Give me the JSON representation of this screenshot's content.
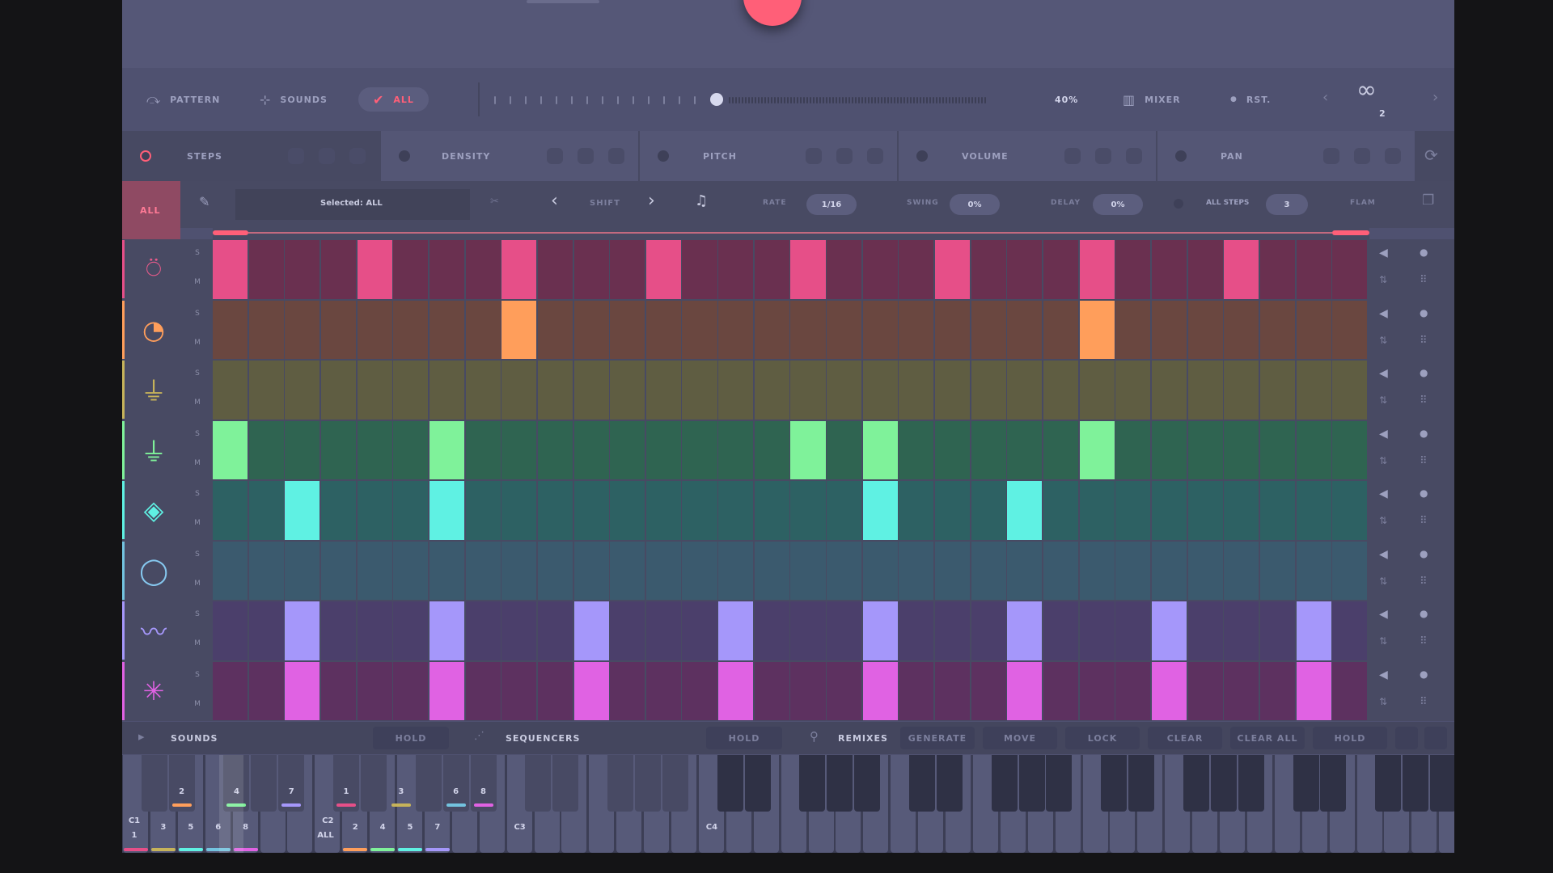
{
  "toolbar": {
    "pattern": "PATTERN",
    "sounds": "SOUNDS",
    "all": "ALL",
    "percent": "40%",
    "mixer": "MIXER",
    "rst": "RST.",
    "loop_count": "2"
  },
  "tabs": {
    "steps": "STEPS",
    "density": "DENSITY",
    "pitch": "PITCH",
    "volume": "VOLUME",
    "pan": "PAN"
  },
  "options": {
    "all_tab": "ALL",
    "selected": "Selected: ALL",
    "shift": "SHIFT",
    "rate_label": "RATE",
    "rate_value": "1/16",
    "swing_label": "SWING",
    "swing_value": "0%",
    "delay_label": "DELAY",
    "delay_value": "0%",
    "all_steps_label": "ALL STEPS",
    "all_steps_value": "3",
    "flam": "FLAM"
  },
  "row_markers": {
    "solo": "S",
    "mute": "M"
  },
  "colors": {
    "row_bg": [
      "#6a3050",
      "#6a4740",
      "#5f5d42",
      "#2f6451",
      "#2d6163",
      "#3b5a6e",
      "#4b3f6b",
      "#5d3160"
    ],
    "row_on": [
      "#e64f88",
      "#ff9e5b",
      "#c6b35a",
      "#7ff29a",
      "#5ff1e3",
      "#73c3df",
      "#a597fa",
      "#e062e3"
    ],
    "row_icon": [
      "#e65a8a",
      "#ff9e5b",
      "#c6b35a",
      "#7ff29a",
      "#5ff1e3",
      "#86c8ef",
      "#a597fa",
      "#e062e3"
    ]
  },
  "tracks": [
    {
      "icon": "kick-drum-icon",
      "glyph": "⍥",
      "steps": [
        0,
        4,
        8,
        12,
        16,
        20,
        24,
        28
      ]
    },
    {
      "icon": "snare-icon",
      "glyph": "◔",
      "steps": [
        8,
        24
      ]
    },
    {
      "icon": "hihat-closed-icon",
      "glyph": "⏚",
      "steps": []
    },
    {
      "icon": "hihat-open-icon",
      "glyph": "⏚",
      "steps": [
        0,
        6,
        16,
        18,
        24
      ]
    },
    {
      "icon": "clap-icon",
      "glyph": "◈",
      "steps": [
        2,
        6,
        18,
        22
      ]
    },
    {
      "icon": "tambourine-icon",
      "glyph": "◯",
      "steps": []
    },
    {
      "icon": "synth-wave-icon",
      "glyph": "〰",
      "steps": [
        2,
        6,
        10,
        14,
        18,
        22,
        26,
        30
      ]
    },
    {
      "icon": "spark-fx-icon",
      "glyph": "✳",
      "steps": [
        2,
        6,
        10,
        14,
        18,
        22,
        26,
        30
      ]
    }
  ],
  "bottom": {
    "sounds": "SOUNDS",
    "hold1": "HOLD",
    "sequencers": "SEQUENCERS",
    "hold2": "HOLD",
    "remixes": "REMIXES",
    "generate": "GENERATE",
    "move": "MOVE",
    "lock": "LOCK",
    "clear": "CLEAR",
    "clear_all": "CLEAR ALL",
    "hold3": "HOLD"
  },
  "keyboard": {
    "c1": "C1",
    "c1_sub": "1",
    "c2": "C2",
    "c2_sub": "ALL",
    "c3": "C3",
    "c4": "C4",
    "black_numbers_1": [
      "2",
      "4",
      "7"
    ],
    "white_numbers_1": [
      "3",
      "5",
      "6",
      "8"
    ],
    "black_numbers_2": [
      "1",
      "3",
      "6",
      "8"
    ],
    "white_numbers_2": [
      "2",
      "4",
      "5",
      "7"
    ]
  }
}
